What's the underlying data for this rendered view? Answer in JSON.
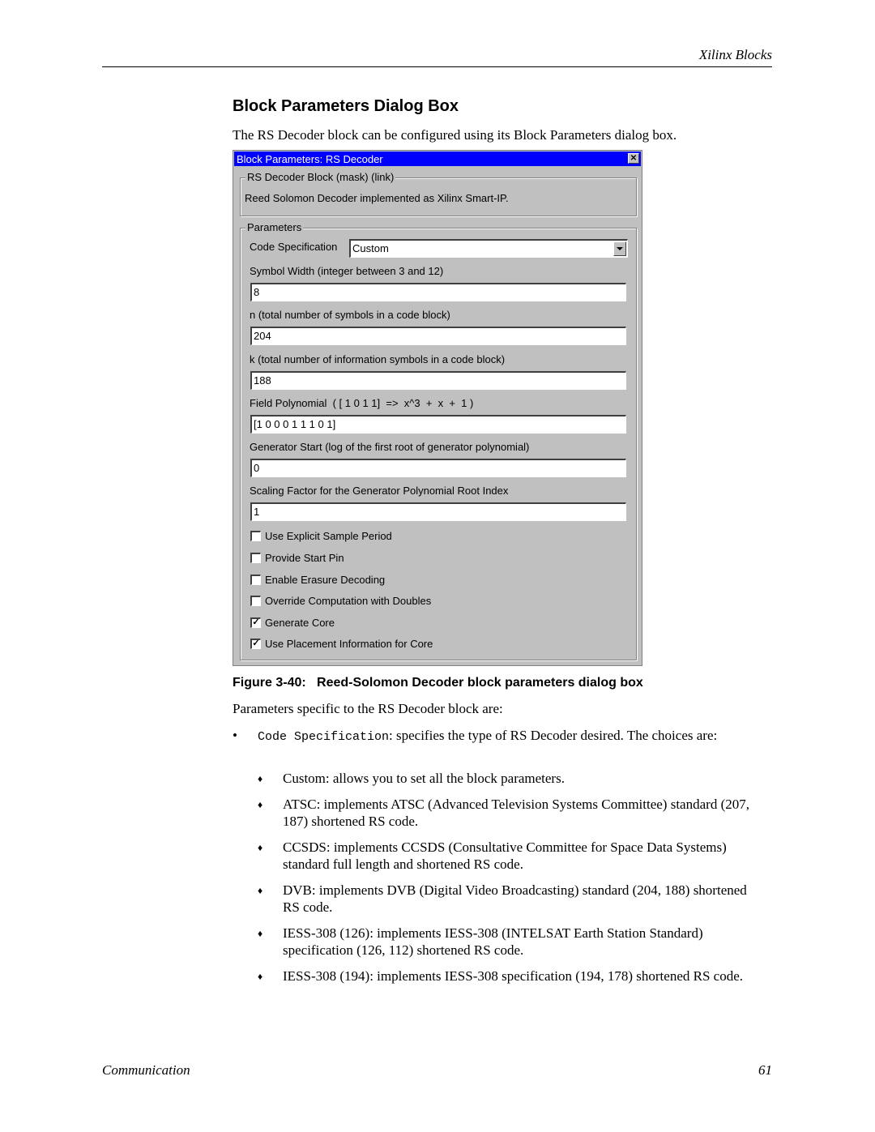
{
  "header": {
    "running_title": "Xilinx Blocks"
  },
  "section": {
    "title": "Block Parameters Dialog Box",
    "intro": "The RS Decoder block can be configured using its Block Parameters dialog box."
  },
  "dialog": {
    "title": "Block Parameters: RS Decoder",
    "close_icon": "close-icon",
    "mask_group": {
      "legend": "RS Decoder Block (mask) (link)",
      "description": "Reed Solomon Decoder implemented as Xilinx Smart-IP."
    },
    "params_group": {
      "legend": "Parameters",
      "code_spec": {
        "label": "Code Specification",
        "value": "Custom"
      },
      "fields": [
        {
          "label": "Symbol Width (integer between 3 and 12)",
          "value": "8"
        },
        {
          "label": "n (total number of symbols in a code block)",
          "value": "204"
        },
        {
          "label": "k (total number of information symbols in a code block)",
          "value": "188"
        },
        {
          "label": "Field Polynomial  ( [ 1 0 1 1]  =>  x^3  +  x  +  1 )",
          "value": "[1 0 0 0 1 1 1 0 1]"
        },
        {
          "label": "Generator Start (log of the first root of generator polynomial)",
          "value": "0"
        },
        {
          "label": "Scaling Factor for the Generator Polynomial Root Index",
          "value": "1"
        }
      ],
      "checkboxes": [
        {
          "label": "Use Explicit Sample Period",
          "checked": false,
          "mark": ""
        },
        {
          "label": "Provide Start Pin",
          "checked": false,
          "mark": ""
        },
        {
          "label": "Enable Erasure Decoding",
          "checked": false,
          "mark": ""
        },
        {
          "label": "Override Computation with Doubles",
          "checked": false,
          "mark": ""
        },
        {
          "label": "Generate Core",
          "checked": true,
          "mark": "✓"
        },
        {
          "label": "Use Placement Information for Core",
          "checked": true,
          "mark": "✓"
        }
      ]
    }
  },
  "caption": "Figure 3-40:   Reed-Solomon Decoder block parameters dialog box",
  "body": {
    "params_intro": "Parameters specific to the RS Decoder block are:",
    "bullet": {
      "symbol": "•",
      "code_term": "Code Specification",
      "text": ": specifies the type of RS Decoder desired. The choices are:"
    },
    "choices": [
      "Custom: allows you to set all the block parameters.",
      "ATSC: implements ATSC (Advanced Television Systems Committee) standard (207, 187) shortened RS code.",
      "CCSDS: implements CCSDS (Consultative Committee for Space Data Systems) standard full length and shortened RS code.",
      "DVB: implements DVB (Digital Video Broadcasting) standard (204, 188) shortened RS code.",
      "IESS-308 (126): implements IESS-308 (INTELSAT Earth Station Standard) specification (126, 112) shortened RS code.",
      "IESS-308 (194): implements IESS-308 specification (194, 178) shortened RS code."
    ],
    "diamond": "♦"
  },
  "footer": {
    "left": "Communication",
    "page_number": "61"
  }
}
